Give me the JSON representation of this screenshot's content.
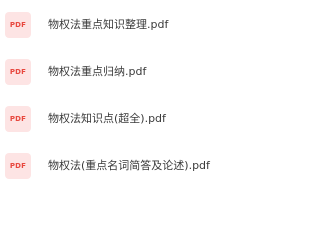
{
  "files": [
    {
      "icon": "pdf-file-icon",
      "icon_label": "PDF",
      "name": "物权法重点知识整理.pdf"
    },
    {
      "icon": "pdf-file-icon",
      "icon_label": "PDF",
      "name": "物权法重点归纳.pdf"
    },
    {
      "icon": "pdf-file-icon",
      "icon_label": "PDF",
      "name": "物权法知识点(超全).pdf"
    },
    {
      "icon": "pdf-file-icon",
      "icon_label": "PDF",
      "name": "物权法(重点名词简答及论述).pdf"
    }
  ],
  "colors": {
    "icon_background": "#fde4e4",
    "icon_text": "#e8483f",
    "file_name_text": "#3a3a3a"
  }
}
